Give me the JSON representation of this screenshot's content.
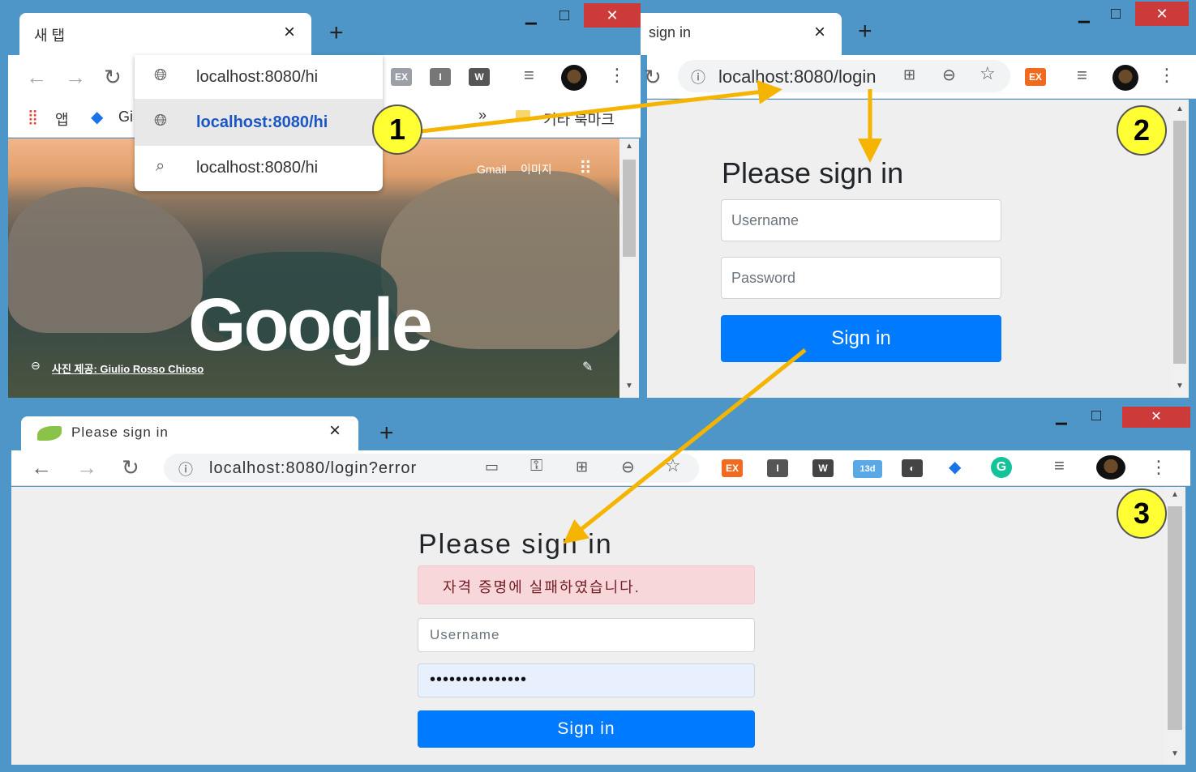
{
  "window1": {
    "tab_title": "새 탭",
    "tab_close": "×",
    "new_tab": "+",
    "bookmarks": {
      "apps": "앱",
      "item2": "Gi",
      "more": "»",
      "other": "기타 북마크"
    },
    "dropdown": [
      {
        "icon": "globe-icon",
        "text": "localhost:8080/hi",
        "selected": false
      },
      {
        "icon": "globe-icon",
        "text": "localhost:8080/hi",
        "selected": true
      },
      {
        "icon": "search-icon",
        "text": "localhost:8080/hi",
        "selected": false
      }
    ],
    "ntp": {
      "gmail": "Gmail",
      "images": "이미지",
      "logo": "Google",
      "credit": "사진 제공: Giulio Rosso Chioso"
    }
  },
  "window2": {
    "tab_title": "sign in",
    "tab_close": "×",
    "new_tab": "+",
    "url": "localhost:8080/login",
    "heading": "Please sign in",
    "username_placeholder": "Username",
    "password_placeholder": "Password",
    "button": "Sign in"
  },
  "window3": {
    "tab_title": "Please sign in",
    "tab_close": "×",
    "new_tab": "+",
    "url": "localhost:8080/login?error",
    "ext_badge": "13d",
    "heading": "Please sign in",
    "error": "자격 증명에 실패하였습니다.",
    "username_placeholder": "Username",
    "password_value": "•••••••••••••••",
    "button": "Sign in"
  },
  "callouts": [
    "1",
    "2",
    "3"
  ],
  "colors": {
    "frame": "#4e96c8",
    "close": "#cd3a3a",
    "primary": "#007bff",
    "error_bg": "#f8d7da",
    "callout": "#ffff33",
    "arrow": "#f5b400"
  }
}
